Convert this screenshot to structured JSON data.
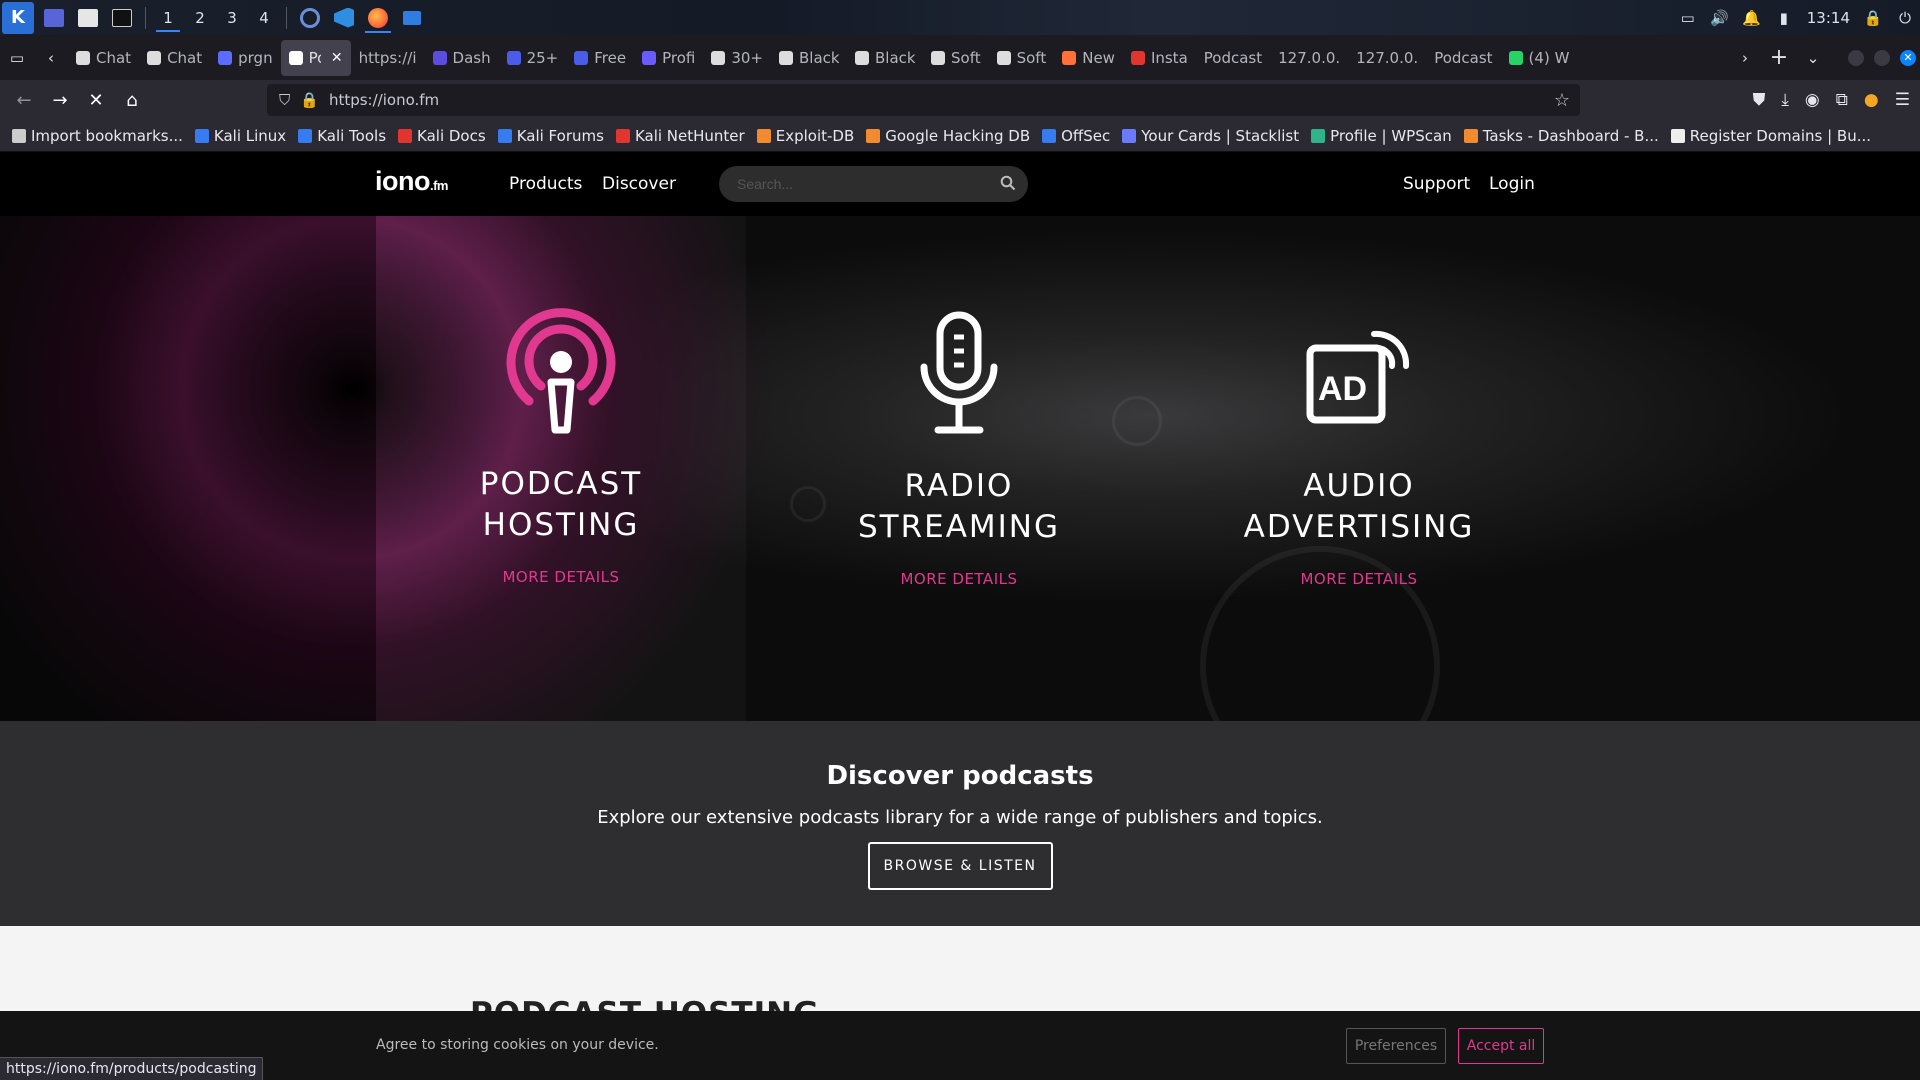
{
  "os_taskbar": {
    "workspaces": [
      "1",
      "2",
      "3",
      "4"
    ],
    "clock": "13:14"
  },
  "browser": {
    "tabs": [
      {
        "label": "Chat",
        "color": "#dddddd"
      },
      {
        "label": "Chat",
        "color": "#dddddd"
      },
      {
        "label": "prgn",
        "color": "#5b6cff"
      },
      {
        "label": "Po",
        "color": "#ffffff",
        "active": true
      },
      {
        "label": "https://i",
        "color": ""
      },
      {
        "label": "Dash",
        "color": "#5b4de0"
      },
      {
        "label": "25+",
        "color": "#4a5de8"
      },
      {
        "label": "Free",
        "color": "#4a5de8"
      },
      {
        "label": "Profi",
        "color": "#6a5bff"
      },
      {
        "label": "30+",
        "color": "#dddddd"
      },
      {
        "label": "Black",
        "color": "#dddddd"
      },
      {
        "label": "Black",
        "color": "#dddddd"
      },
      {
        "label": "Soft",
        "color": "#dddddd"
      },
      {
        "label": "Soft",
        "color": "#dddddd"
      },
      {
        "label": "New",
        "color": "#ff7139"
      },
      {
        "label": "Insta",
        "color": "#e0362f"
      },
      {
        "label": "Podcast",
        "color": ""
      },
      {
        "label": "127.0.0.",
        "color": ""
      },
      {
        "label": "127.0.0.",
        "color": ""
      },
      {
        "label": "Podcast",
        "color": ""
      },
      {
        "label": "(4) W",
        "color": "#25d366"
      }
    ],
    "url": "https://iono.fm",
    "bookmarks": [
      {
        "label": "Import bookmarks...",
        "color": "#cccccc"
      },
      {
        "label": "Kali Linux",
        "color": "#367bf0"
      },
      {
        "label": "Kali Tools",
        "color": "#367bf0"
      },
      {
        "label": "Kali Docs",
        "color": "#e0362f"
      },
      {
        "label": "Kali Forums",
        "color": "#367bf0"
      },
      {
        "label": "Kali NetHunter",
        "color": "#e0362f"
      },
      {
        "label": "Exploit-DB",
        "color": "#f28b30"
      },
      {
        "label": "Google Hacking DB",
        "color": "#f28b30"
      },
      {
        "label": "OffSec",
        "color": "#367bf0"
      },
      {
        "label": "Your Cards | Stacklist",
        "color": "#6b7bff"
      },
      {
        "label": "Profile | WPScan",
        "color": "#2fb38a"
      },
      {
        "label": "Tasks - Dashboard - B...",
        "color": "#f28b30"
      },
      {
        "label": "Register Domains | Bu...",
        "color": "#eeeeee"
      }
    ],
    "status_url": "https://iono.fm/products/podcasting"
  },
  "site": {
    "logo_main": "iono",
    "logo_suffix": ".fm",
    "nav": {
      "products": "Products",
      "discover": "Discover",
      "support": "Support",
      "login": "Login"
    },
    "search_placeholder": "Search...",
    "accent_color": "#e0398f",
    "services": [
      {
        "title_line1": "PODCAST",
        "title_line2": "HOSTING",
        "link": "MORE DETAILS",
        "icon": "podcast-icon"
      },
      {
        "title_line1": "RADIO",
        "title_line2": "STREAMING",
        "link": "MORE DETAILS",
        "icon": "microphone-icon"
      },
      {
        "title_line1": "AUDIO",
        "title_line2": "ADVERTISING",
        "link": "MORE DETAILS",
        "icon": "ad-broadcast-icon"
      }
    ],
    "discover": {
      "heading": "Discover podcasts",
      "text": "Explore our extensive podcasts library for a wide range of publishers and topics.",
      "button": "BROWSE & LISTEN"
    },
    "next_section_heading": "PODCAST HOSTING",
    "cookie": {
      "text": "Agree to storing cookies on your device.",
      "preferences": "Preferences",
      "accept": "Accept all"
    }
  }
}
